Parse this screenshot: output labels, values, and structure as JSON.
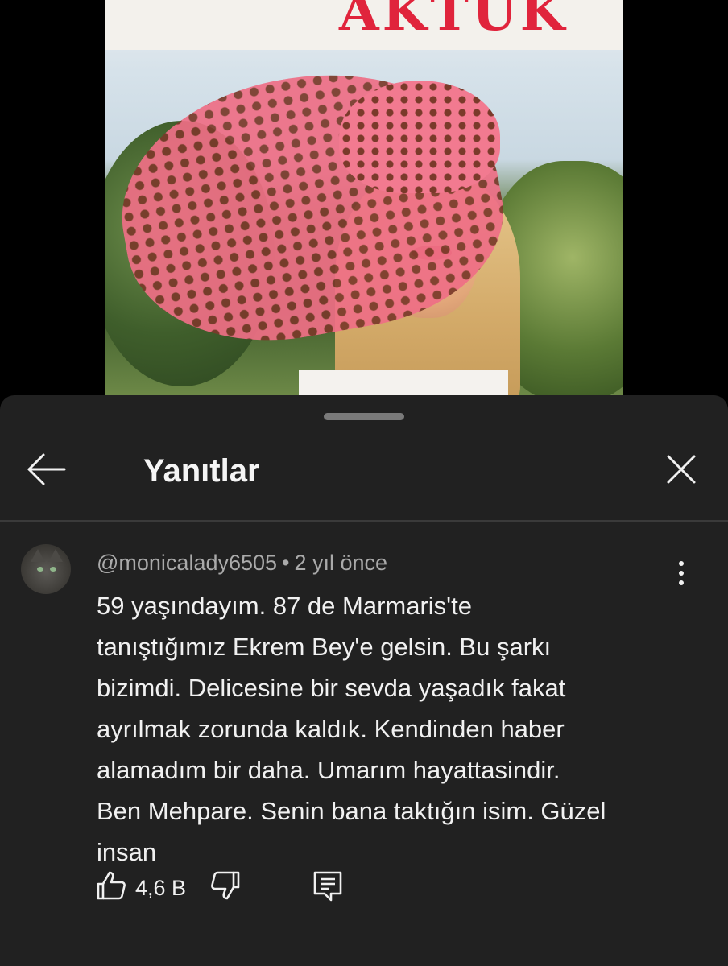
{
  "video": {
    "cover_title_fragment": "AKTUK"
  },
  "sheet": {
    "title": "Yanıtlar",
    "icons": {
      "back": "arrow-left-icon",
      "close": "close-icon"
    }
  },
  "comment": {
    "author": "@monicalady6505",
    "separator": "•",
    "time": "2 yıl önce",
    "lines": [
      "59 yaşındayım. 87 de Marmaris'te",
      "tanıştığımız Ekrem Bey'e gelsin. Bu şarkı",
      "bizimdi. Delicesine bir sevda yaşadık fakat",
      "ayrılmak zorunda kaldık. Kendinden haber",
      "alamadım bir daha. Umarım hayattasindir.",
      "Ben Mehpare. Senin bana taktığın isim. Güzel",
      "insan"
    ],
    "likes": "4,6 B",
    "icons": {
      "more": "more-vertical-icon",
      "like": "thumbs-up-icon",
      "dislike": "thumbs-down-icon",
      "reply": "reply-icon"
    }
  },
  "colors": {
    "sheet_background": "#212121",
    "primary_text": "#f1f1f1",
    "secondary_text": "#aaaaaa",
    "cover_title": "#e0243c",
    "hat": "#ef6f86"
  }
}
